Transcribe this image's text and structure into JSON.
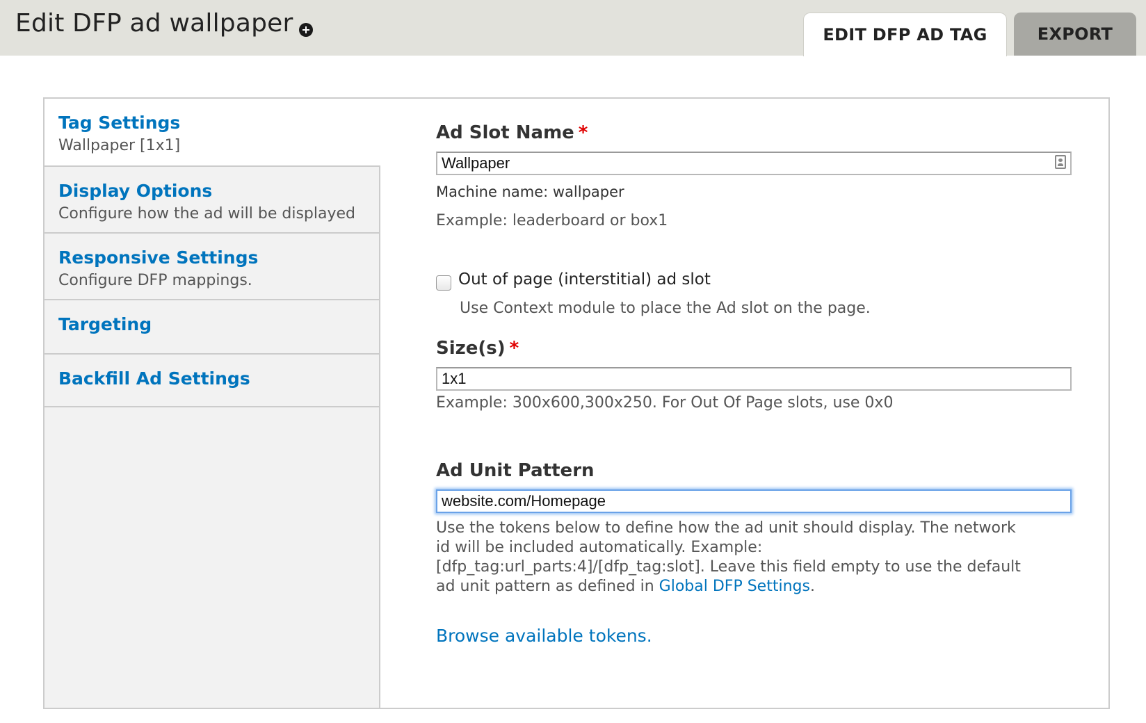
{
  "header": {
    "title": "Edit DFP ad wallpaper",
    "add_icon": "circle-plus-icon",
    "tabs": [
      {
        "label": "EDIT DFP AD TAG",
        "active": true
      },
      {
        "label": "EXPORT",
        "active": false
      }
    ]
  },
  "sidebar": {
    "items": [
      {
        "title": "Tag Settings",
        "summary": "Wallpaper [1x1]",
        "active": true
      },
      {
        "title": "Display Options",
        "summary": "Configure how the ad will be displayed",
        "active": false
      },
      {
        "title": "Responsive Settings",
        "summary": "Configure DFP mappings.",
        "active": false
      },
      {
        "title": "Targeting",
        "summary": "",
        "active": false
      },
      {
        "title": "Backfill Ad Settings",
        "summary": "",
        "active": false
      }
    ]
  },
  "form": {
    "slot_name": {
      "label": "Ad Slot Name",
      "required_mark": "*",
      "value": "Wallpaper",
      "machine_name": "Machine name: wallpaper",
      "description": "Example: leaderboard or box1"
    },
    "out_of_page": {
      "label": "Out of page (interstitial) ad slot",
      "checked": false,
      "description": "Use Context module to place the Ad slot on the page."
    },
    "sizes": {
      "label": "Size(s)",
      "required_mark": "*",
      "value": "1x1",
      "description": "Example: 300x600,300x250. For Out Of Page slots, use 0x0"
    },
    "ad_unit": {
      "label": "Ad Unit Pattern",
      "value": "website.com/Homepage",
      "description_lines": [
        "Use the tokens below to define how the ad unit should display. The network",
        "id will be included automatically. Example:",
        "[dfp_tag:url_parts:4]/[dfp_tag:slot]. Leave this field empty to use the default"
      ],
      "description_last_prefix": "ad unit pattern as defined in ",
      "description_link": "Global DFP Settings",
      "description_last_suffix": "."
    },
    "browse_tokens": "Browse available tokens."
  },
  "colors": {
    "link": "#0074bd",
    "required": "#e00000",
    "header_bg": "#e2e2dc",
    "focus_ring": "#6aa2e8"
  }
}
